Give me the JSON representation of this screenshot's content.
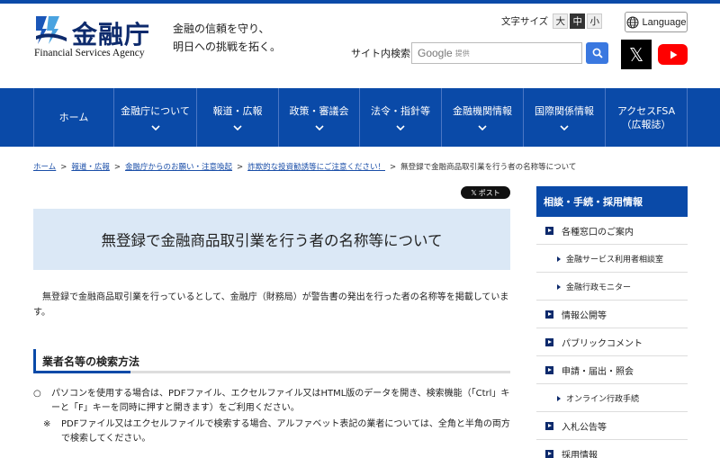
{
  "header": {
    "logo_name": "金融庁",
    "logo_en": "Financial Services Agency",
    "tagline_line1": "金融の信頼を守り、",
    "tagline_line2": "明日への挑戦を拓く。",
    "font_size_label": "文字サイズ",
    "font_sizes": [
      "大",
      "中",
      "小"
    ],
    "font_size_selected": "中",
    "language_label": "Language",
    "search_label": "サイト内検索",
    "search_google": "Google",
    "search_provided": "提供",
    "x_icon_glyph": "𝕏"
  },
  "nav": {
    "items": [
      {
        "label": "ホーム",
        "chevron": false
      },
      {
        "label": "金融庁について",
        "chevron": true
      },
      {
        "label": "報道・広報",
        "chevron": true
      },
      {
        "label": "政策・審議会",
        "chevron": true
      },
      {
        "label": "法令・指針等",
        "chevron": true
      },
      {
        "label": "金融機関情報",
        "chevron": true
      },
      {
        "label": "国際関係情報",
        "chevron": true
      },
      {
        "label": "アクセスFSA（広報誌）",
        "chevron": false
      }
    ]
  },
  "breadcrumb": {
    "links": [
      "ホーム",
      "報道・広報",
      "金融庁からのお願い・注意喚起",
      "詐欺的な投資勧誘等にご注意ください！"
    ],
    "current": "無登録で金融商品取引業を行う者の名称等について",
    "separator": ">"
  },
  "share": {
    "post_label": "ポスト",
    "post_icon": "𝕏"
  },
  "main": {
    "title": "無登録で金融商品取引業を行う者の名称等について",
    "intro": "無登録で金融商品取引業を行っているとして、金融庁（財務局）が警告書の発出を行った者の名称等を掲載しています。",
    "section_heading": "業者名等の検索方法",
    "item1_bullet": "○",
    "item1_text": "パソコンを使用する場合は、PDFファイル、エクセルファイル又はHTML版のデータを開き、検索機能（「Ctrl」キーと「F」キーを同時に押すと開きます）をご利用ください。",
    "item2_bullet": "※",
    "item2_text": "PDFファイル又はエクセルファイルで検索する場合、アルファベット表記の業者については、全角と半角の両方で検索してください。"
  },
  "sidebar": {
    "heading": "相談・手続・採用情報",
    "items": [
      {
        "label": "各種窓口のご案内",
        "level": "main"
      },
      {
        "label": "金融サービス利用者相談室",
        "level": "sub"
      },
      {
        "label": "金融行政モニター",
        "level": "sub"
      },
      {
        "label": "情報公開等",
        "level": "main"
      },
      {
        "label": "パブリックコメント",
        "level": "main"
      },
      {
        "label": "申請・届出・照会",
        "level": "main"
      },
      {
        "label": "オンライン行政手続",
        "level": "sub"
      },
      {
        "label": "入札公告等",
        "level": "main"
      },
      {
        "label": "採用情報",
        "level": "main"
      }
    ]
  },
  "colors": {
    "brand": "#0a4aa8",
    "title_bg": "#dbe8f6",
    "youtube": "#ff0000"
  }
}
